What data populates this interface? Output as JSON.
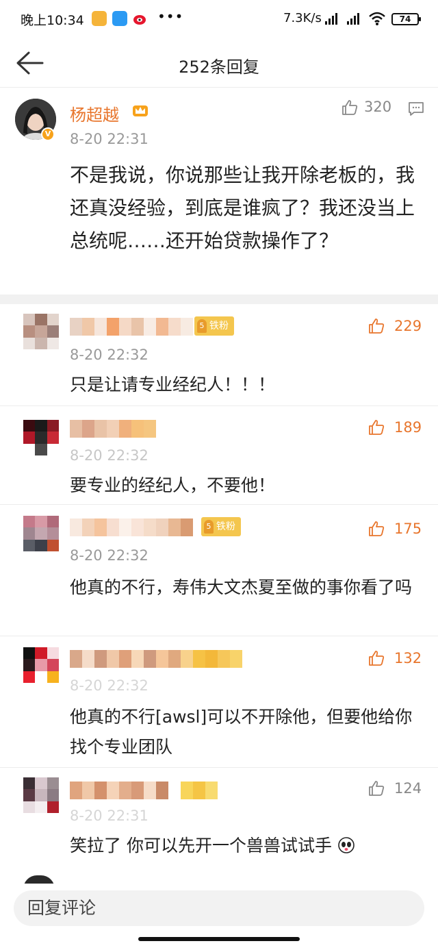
{
  "status_bar": {
    "time": "晚上10:34",
    "dots": "•••",
    "net_speed": "7.3K/s",
    "battery": "74"
  },
  "header": {
    "title": "252条回复",
    "back_icon": "arrow-left-icon"
  },
  "post": {
    "author": "杨超越",
    "time": "8-20 22:31",
    "likes": "320",
    "text": "不是我说，你说那些让我开除老板的，我还真没经验，到底是谁疯了？我还没当上总统呢……还开始贷款操作了？"
  },
  "replies": [
    {
      "badge": "铁粉",
      "time": "8-20 22:32",
      "likes": "229",
      "liked": true,
      "text": "只是让请专业经纪人！！！"
    },
    {
      "badge": "",
      "time": "8-20 22:32",
      "likes": "189",
      "liked": true,
      "text": "要专业的经纪人，不要他！"
    },
    {
      "badge": "铁粉",
      "time": "8-20 22:32",
      "likes": "175",
      "liked": true,
      "text": "他真的不行，寿伟大文杰夏至做的事你看了吗"
    },
    {
      "badge": "",
      "time": "8-20 22:32",
      "likes": "132",
      "liked": true,
      "text": "他真的不行[awsl]可以不开除他，但要他给你找个专业团队"
    },
    {
      "badge": "",
      "time": "8-20 22:31",
      "likes": "124",
      "liked": false,
      "text": "笑拉了 你可以先开一个兽兽试试手"
    }
  ],
  "colors": {
    "accent_orange": "#e8762d",
    "gray_text": "#999999",
    "liked": "#e8762d",
    "unliked": "#888888"
  },
  "bottom": {
    "reply_placeholder": "回复评论"
  }
}
